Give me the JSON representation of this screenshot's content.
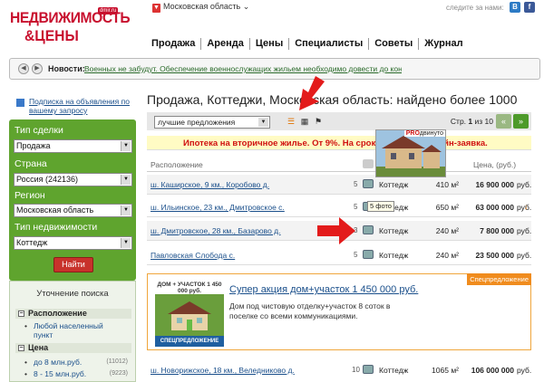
{
  "header": {
    "logo_line1": "НЕДВИЖИМОСТЬ",
    "logo_line2": "&ЦЕНЫ",
    "logo_badge": "dmir.ru",
    "region": "Московская область",
    "follow": "следите за нами:",
    "social": [
      "B",
      "f"
    ]
  },
  "nav": [
    "Продажа",
    "Аренда",
    "Цены",
    "Специалисты",
    "Советы",
    "Журнал"
  ],
  "news": {
    "label": "Новости:",
    "text": "Военных не забудут. Обеспечение военнослужащих жильем необходимо довести до конц..."
  },
  "sidebar": {
    "subscribe": "Подписка на объявления по вашему запросу",
    "fields": [
      {
        "label": "Тип сделки",
        "value": "Продажа"
      },
      {
        "label": "Страна",
        "value": "Россия (242136)"
      },
      {
        "label": "Регион",
        "value": "Московская область"
      },
      {
        "label": "Тип недвижимости",
        "value": "Коттедж"
      }
    ],
    "find": "Найти",
    "refine_title": "Уточнение поиска",
    "sec_location": "Расположение",
    "loc_item": "Любой населенный пункт",
    "sec_price": "Цена",
    "price_items": [
      {
        "label": "до 8 млн.руб.",
        "count": "(11012)"
      },
      {
        "label": "8 - 15 млн.руб.",
        "count": "(9223)"
      }
    ]
  },
  "main": {
    "title": "Продажа, Коттеджи, Московская область: найдено более 1000",
    "sort": "лучшие предложения",
    "page_prefix": "Стр.",
    "page_current": "1",
    "page_of": "из 10",
    "promo": "Ипотека на вторичное жилье. От 9%. На срок до 30 лет. Онлайн-заявка.",
    "headers": {
      "location": "Расположение",
      "price": "Цена, (руб.)"
    },
    "rows": [
      {
        "loc": "ш. Каширское, 9 км., Коробово д.",
        "n": "5",
        "type": "Коттедж",
        "area": "410 м²",
        "price": "16 900 000",
        "cur": "руб."
      },
      {
        "loc": "ш. Ильинское, 23 км., Дмитровское с.",
        "n": "5",
        "type": "Коттедж",
        "area": "650 м²",
        "price": "63 000 000",
        "cur": "руб."
      },
      {
        "loc": "ш. Дмитровское, 28 км., Базарово д.",
        "n": "3",
        "type": "Коттедж",
        "area": "240 м²",
        "price": "7 800 000",
        "cur": "руб."
      },
      {
        "loc": "Павловская Слобода с.",
        "n": "5",
        "type": "Коттедж",
        "area": "240 м²",
        "price": "23 500 000",
        "cur": "руб."
      },
      {
        "loc": "ш. Новорижское, 18 км., Веледниково д.",
        "n": "10",
        "type": "Коттедж",
        "area": "1065 м²",
        "price": "106 000 000",
        "cur": "руб."
      }
    ],
    "tooltip": "5 фото",
    "photo_badge_pro": "PRO",
    "photo_badge_rest": "двинуто",
    "special": {
      "tag": "Спецпредложение",
      "img_top": "ДОМ + УЧАСТОК 1 450 000 руб.",
      "img_bottom": "СПЕЦПРЕДЛОЖЕНИЕ",
      "title": "Супер акция дом+участок 1 450 000 руб.",
      "desc": "Дом под чистовую отделку+участок 8 соток в поселке со всеми коммуникациями."
    }
  }
}
